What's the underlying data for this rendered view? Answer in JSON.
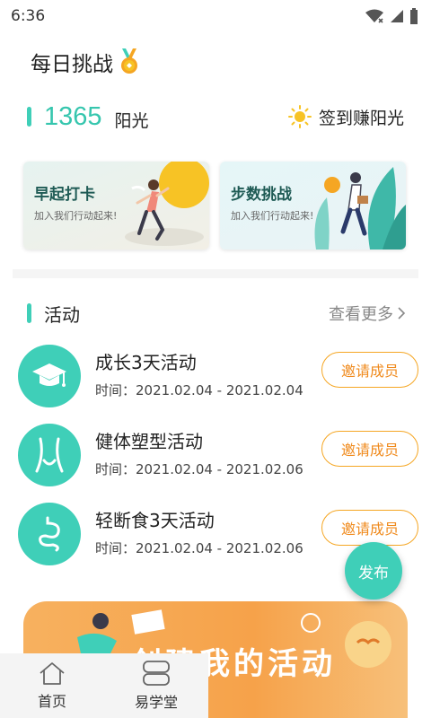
{
  "status_bar": {
    "time": "6:36"
  },
  "header": {
    "title": "每日挑战",
    "medal_icon": "medal-icon"
  },
  "sunshine": {
    "count": "1365",
    "unit": "阳光",
    "checkin_label": "签到赚阳光"
  },
  "cards": [
    {
      "title": "早起打卡",
      "subtitle": "加入我们行动起来!"
    },
    {
      "title": "步数挑战",
      "subtitle": "加入我们行动起来!"
    }
  ],
  "activities_section": {
    "title": "活动",
    "more_label": "查看更多"
  },
  "activities": [
    {
      "name": "成长3天活动",
      "time_label": "时间：",
      "time": "2021.02.04 - 2021.02.04",
      "button": "邀请成员",
      "icon": "graduation-cap-icon"
    },
    {
      "name": "健体塑型活动",
      "time_label": "时间：",
      "time": "2021.02.04 - 2021.02.06",
      "button": "邀请成员",
      "icon": "body-icon"
    },
    {
      "name": "轻断食3天活动",
      "time_label": "时间：",
      "time": "2021.02.04 - 2021.02.06",
      "button": "邀请成员",
      "icon": "stomach-icon"
    }
  ],
  "fab": {
    "label": "发布"
  },
  "banner": {
    "text": "创建我的活动"
  },
  "tabbar": [
    {
      "label": "首页",
      "icon": "home-icon"
    },
    {
      "label": "易学堂",
      "icon": "school-icon"
    }
  ],
  "colors": {
    "accent": "#3fcfb8",
    "orange": "#f5a623",
    "sun": "#f7c325"
  }
}
